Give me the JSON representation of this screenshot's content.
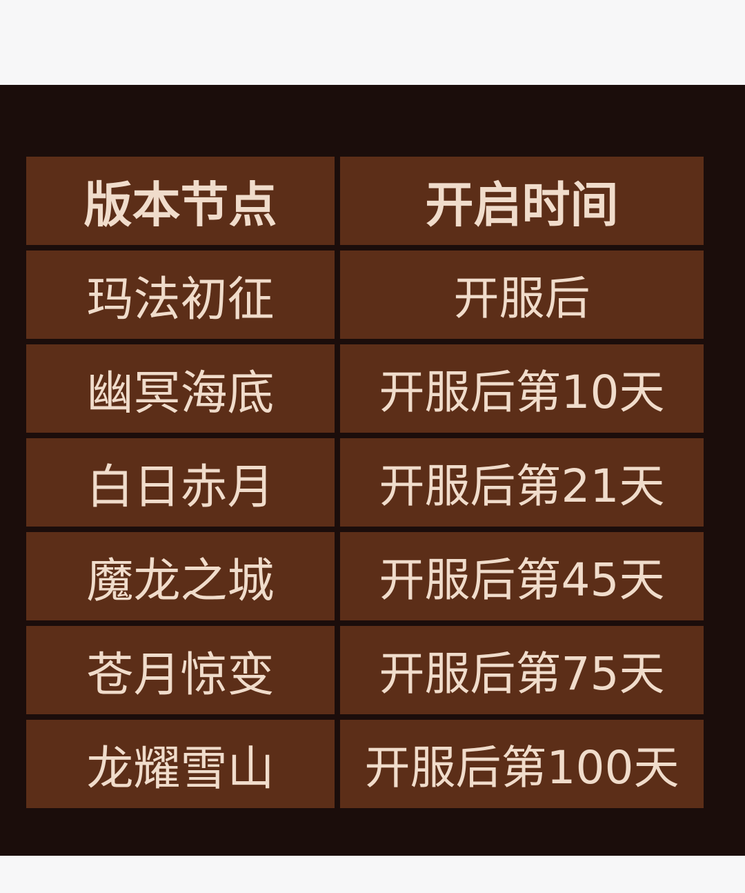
{
  "table": {
    "headers": [
      "版本节点",
      "开启时间"
    ],
    "rows": [
      {
        "version": "玛法初征",
        "time": "开服后"
      },
      {
        "version": "幽冥海底",
        "time": "开服后第10天"
      },
      {
        "version": "白日赤月",
        "time": "开服后第21天"
      },
      {
        "version": "魔龙之城",
        "time": "开服后第45天"
      },
      {
        "version": "苍月惊变",
        "time": "开服后第75天"
      },
      {
        "version": "龙耀雪山",
        "time": "开服后第100天"
      }
    ]
  }
}
